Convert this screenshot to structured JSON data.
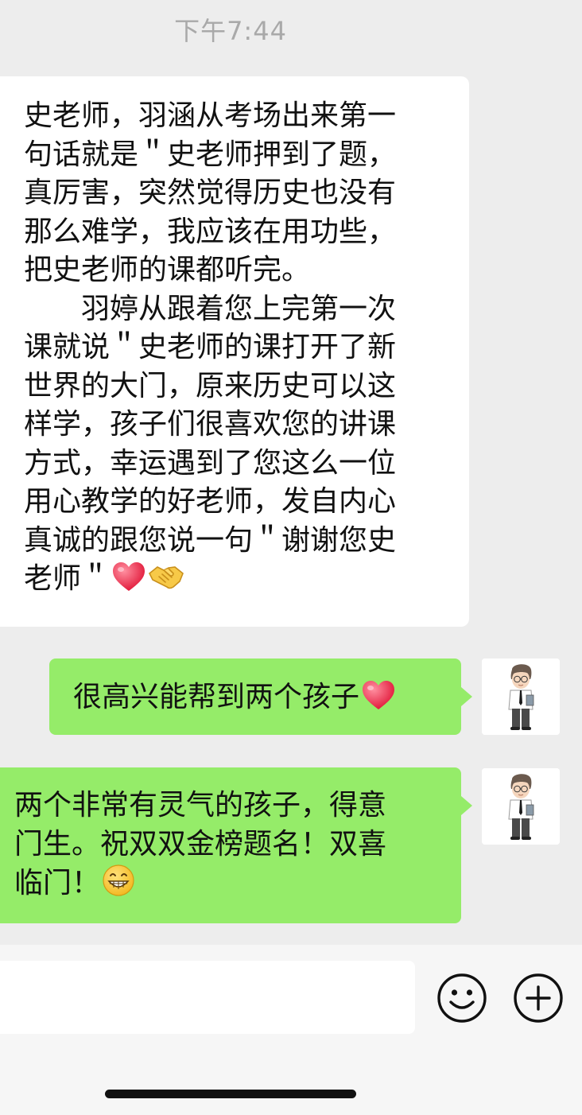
{
  "status": {
    "time": "下午7:44"
  },
  "messages": [
    {
      "side": "left",
      "text": "史老师，羽涵从考场出来第一\n句话就是＂史老师押到了题，\n真厉害，突然觉得历史也没有\n那么难学，我应该在用功些，\n把史老师的课都听完。\n　　羽婷从跟着您上完第一次\n课就说＂史老师的课打开了新\n世界的大门，原来历史可以这\n样学，孩子们很喜欢您的讲课\n方式，幸运遇到了您这么一位\n用心教学的好老师，发自内心\n真诚的跟您说一句＂谢谢您史\n老师＂",
      "emojis": [
        "heart-emoji",
        "handshake-emoji"
      ]
    },
    {
      "side": "right",
      "text": "很高兴能帮到两个孩子",
      "emojis": [
        "heart-emoji"
      ]
    },
    {
      "side": "right",
      "text": "两个非常有灵气的孩子，得意\n门生。祝双双金榜题名！双喜\n临门！",
      "emojis": [
        "grin-emoji"
      ]
    }
  ],
  "colors": {
    "background": "#ededed",
    "bubble_incoming": "#ffffff",
    "bubble_outgoing": "#95ec69",
    "timestamp": "#a9a9a9"
  },
  "icons": {
    "emoji_button": "smile-icon",
    "more_button": "plus-circle-icon"
  }
}
